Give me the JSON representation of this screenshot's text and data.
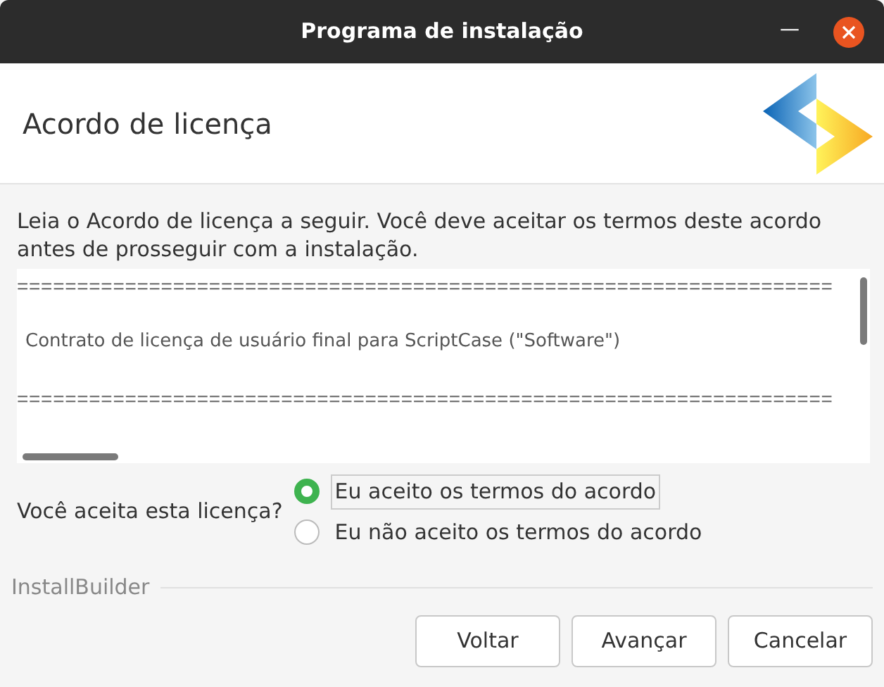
{
  "window": {
    "title": "Programa de instalação",
    "controls": [
      {
        "kind": "minimize",
        "label": "—"
      },
      {
        "kind": "close"
      }
    ]
  },
  "header": {
    "title": "Acordo de licença"
  },
  "intro": "Leia o Acordo de licença a seguir. Você deve aceitar os termos deste acordo antes de prosseguir com a instalação.",
  "license_lines": [
    {
      "kind": "rule",
      "text": "===================================================================="
    },
    {
      "kind": "text",
      "text": "Contrato de licença de usuário final para ScriptCase (\"Software\")"
    },
    {
      "kind": "rule",
      "text": "===================================================================="
    }
  ],
  "question": {
    "label": "Você aceita esta licença?",
    "options": [
      {
        "label": "Eu aceito os termos do acordo",
        "selected": true
      },
      {
        "label": "Eu não aceito os termos do acordo",
        "selected": false
      }
    ]
  },
  "footer": {
    "brand": "InstallBuilder",
    "buttons": [
      "Voltar",
      "Avançar",
      "Cancelar"
    ]
  }
}
